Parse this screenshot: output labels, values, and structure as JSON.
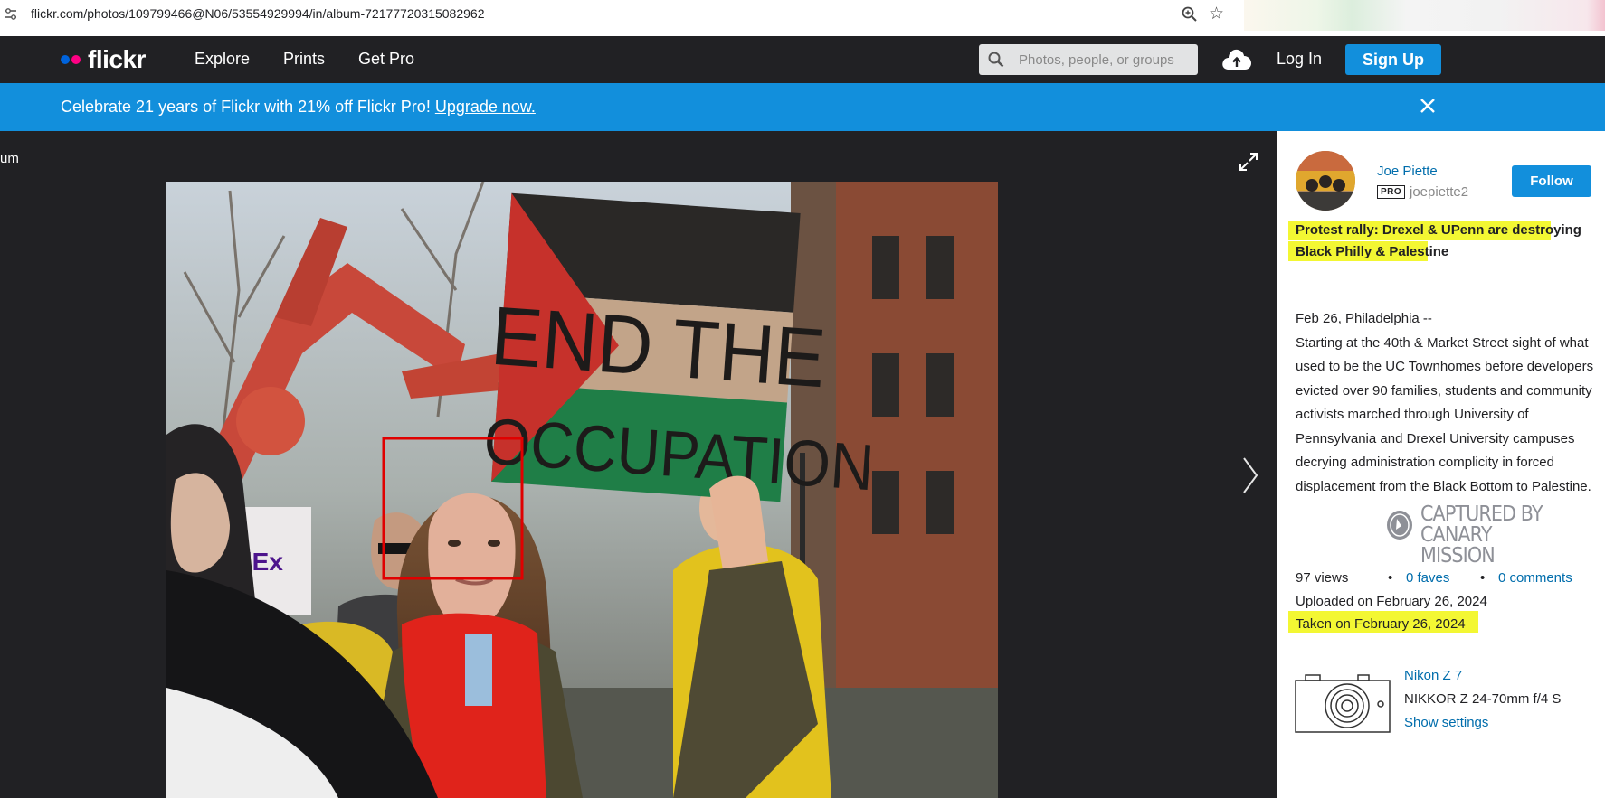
{
  "browser": {
    "url": "flickr.com/photos/109799466@N06/53554929994/in/album-72177720315082962"
  },
  "nav": {
    "logo": "flickr",
    "links": [
      "Explore",
      "Prints",
      "Get Pro"
    ],
    "search_placeholder": "Photos, people, or groups",
    "login": "Log In",
    "signup": "Sign Up"
  },
  "banner": {
    "text": "Celebrate 21 years of Flickr with 21% off Flickr Pro! ",
    "link": "Upgrade now."
  },
  "photo_area": {
    "back_label": "um",
    "sign_line1": "END THE",
    "sign_line2": "OCCUPATION",
    "truck_text": "edEx"
  },
  "author": {
    "name": "Joe Piette",
    "pro_badge": "PRO",
    "username": "joepiette2",
    "follow": "Follow"
  },
  "photo_info": {
    "title_line1": "Protest rally: Drexel & UPenn are destroying",
    "title_line2": "Black Philly & Palestine",
    "description": "Feb 26, Philadelphia --\nStarting at the 40th & Market Street sight of what used to be the UC Townhomes before developers evicted over 90 families, students and community activists marched through University of Pennsylvania and Drexel University campuses decrying administration complicity in forced displacement from the Black Bottom to Palestine.",
    "watermark_line1": "CAPTURED BY",
    "watermark_line2": "CANARY MISSION",
    "views": "97 views",
    "faves": "0 faves",
    "comments": "0 comments",
    "uploaded": "Uploaded on February 26, 2024",
    "taken": "Taken on February 26, 2024"
  },
  "camera": {
    "name": "Nikon Z 7",
    "lens": "NIKKOR Z 24-70mm f/4 S",
    "settings": "Show settings"
  },
  "colors": {
    "nav_bg": "#212124",
    "accent_blue": "#128fdc",
    "link_blue": "#006dac",
    "highlight": "#f3f733",
    "face_box": "#e00000"
  },
  "icons": [
    "site-info-icon",
    "zoom-icon",
    "star-icon",
    "search-icon",
    "upload-cloud-icon",
    "close-icon",
    "expand-icon",
    "chevron-right-icon",
    "camera-icon",
    "canary-mission-logo"
  ]
}
